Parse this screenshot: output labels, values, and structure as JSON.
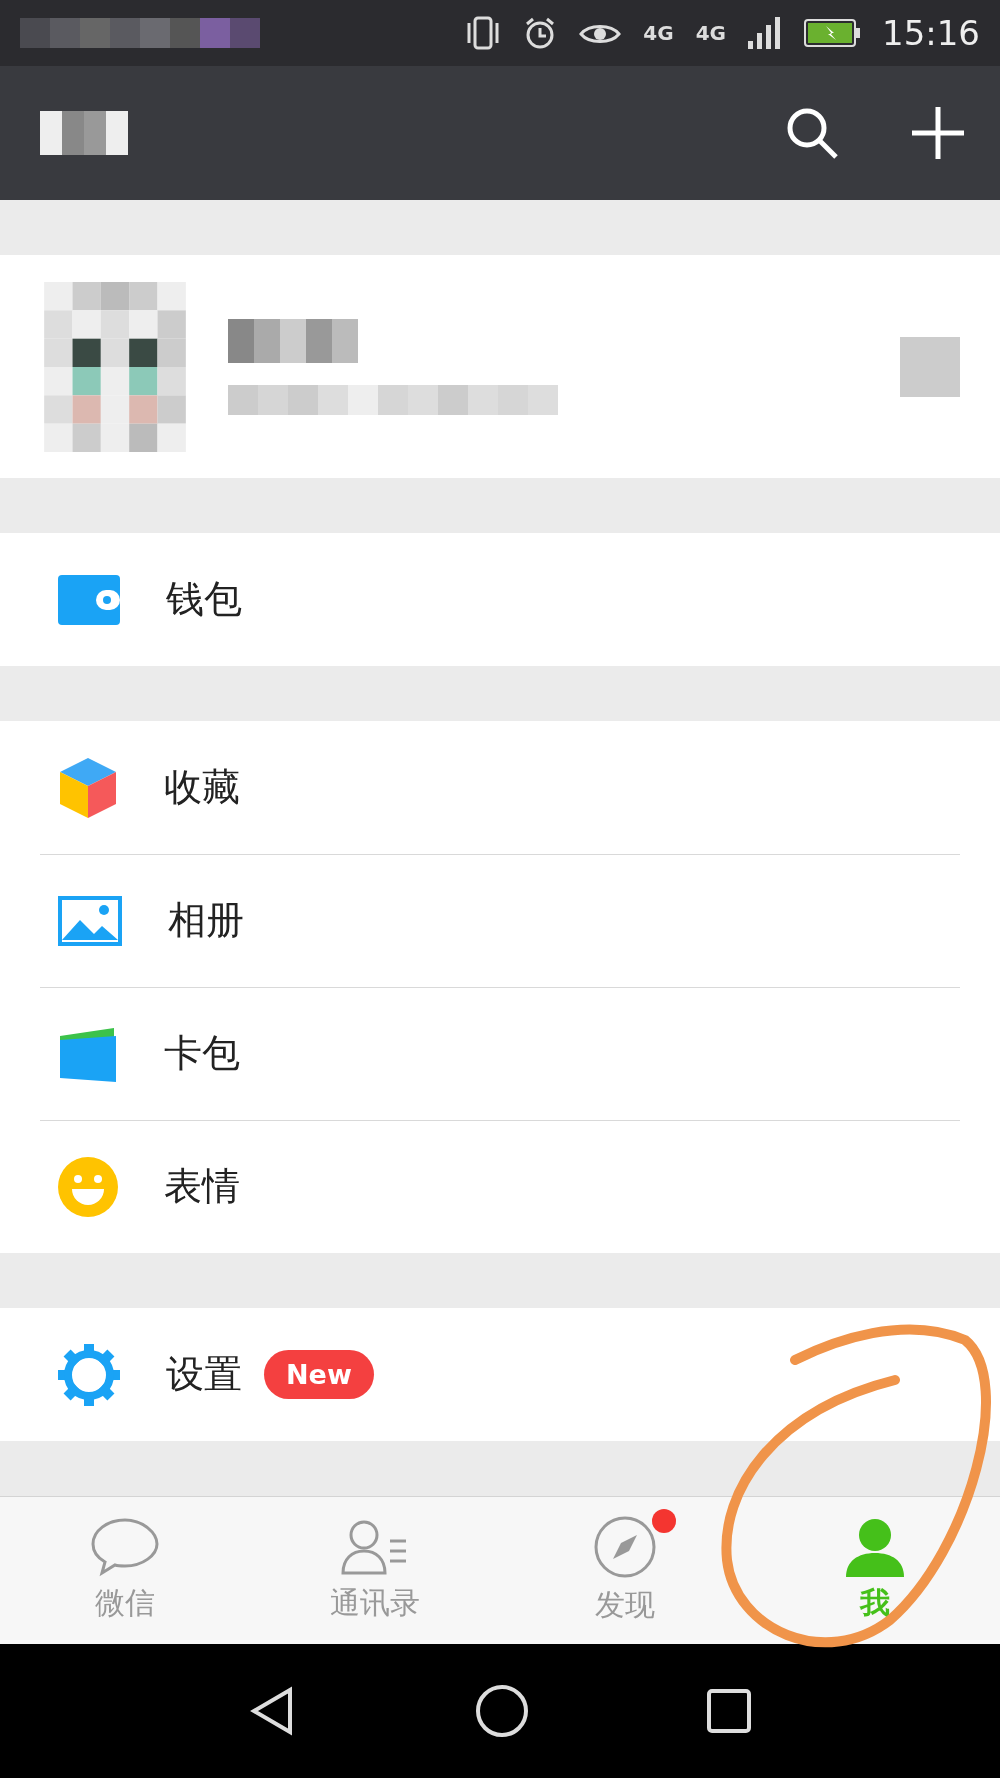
{
  "status_bar": {
    "network_labels": [
      "4G",
      "4G"
    ],
    "time": "15:16"
  },
  "menu_groups": [
    [
      {
        "label": "钱包",
        "kind": "wallet"
      }
    ],
    [
      {
        "label": "收藏",
        "kind": "favorites"
      },
      {
        "label": "相册",
        "kind": "album"
      },
      {
        "label": "卡包",
        "kind": "cards"
      },
      {
        "label": "表情",
        "kind": "sticker"
      }
    ],
    [
      {
        "label": "设置",
        "kind": "settings",
        "badge": "New"
      }
    ]
  ],
  "tabs": [
    {
      "label": "微信",
      "kind": "chat",
      "selected": false,
      "dot": false
    },
    {
      "label": "通讯录",
      "kind": "contacts",
      "selected": false,
      "dot": false
    },
    {
      "label": "发现",
      "kind": "discover",
      "selected": false,
      "dot": true
    },
    {
      "label": "我",
      "kind": "me",
      "selected": true,
      "dot": false
    }
  ]
}
